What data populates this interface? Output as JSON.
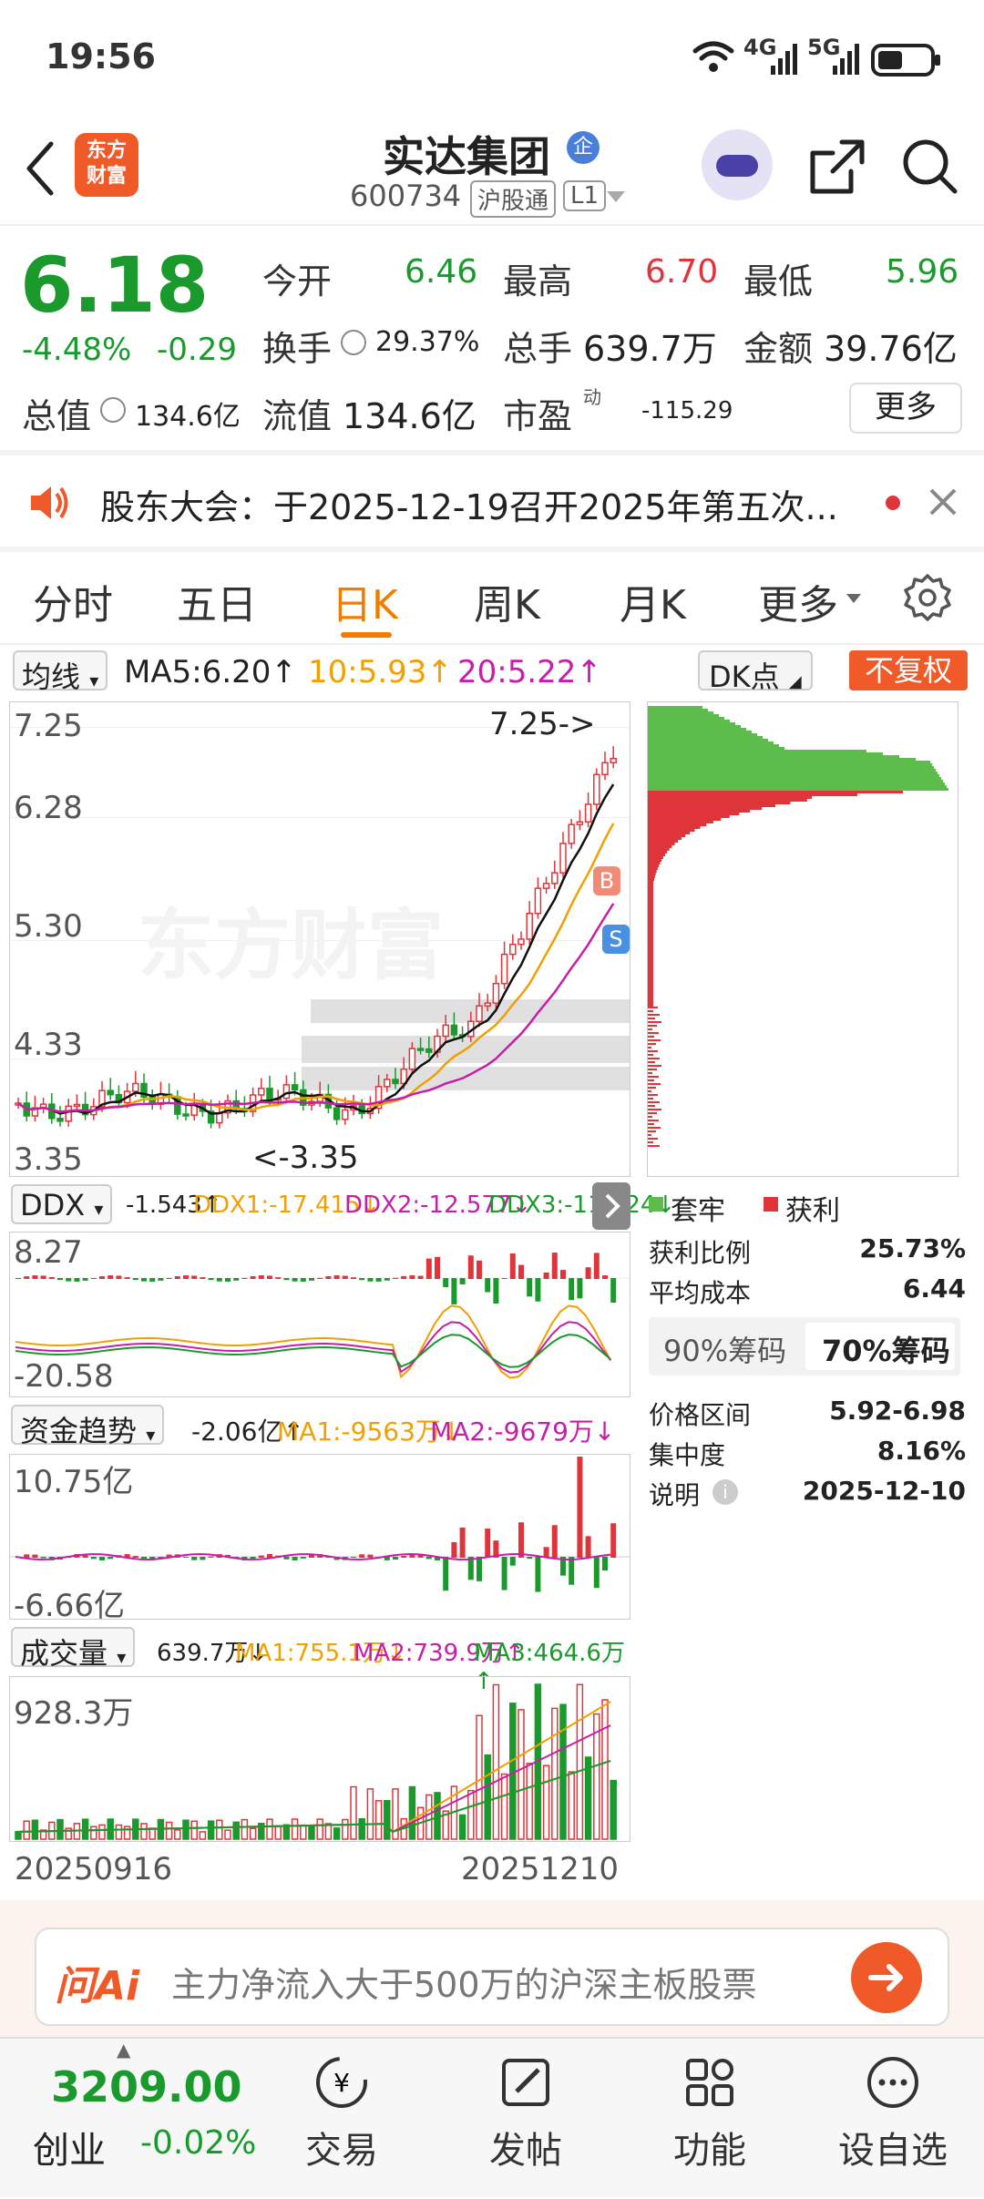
{
  "status": {
    "time": "19:56",
    "net1": "4G",
    "net2": "5G"
  },
  "header": {
    "title": "实达集团",
    "badge": "企",
    "code": "600734",
    "tag1": "沪股通",
    "tag2": "L1",
    "logo": "东方\n财富"
  },
  "quote": {
    "price": "6.18",
    "pct": "-4.48%",
    "chg": "-0.29",
    "open_label": "今开",
    "open": "6.46",
    "high_label": "最高",
    "high": "6.70",
    "low_label": "最低",
    "low": "5.96",
    "turnover_label": "换手",
    "turnover": "29.37%",
    "volume_label": "总手",
    "volume": "639.7万",
    "amount_label": "金额",
    "amount": "39.76亿",
    "mcap_label": "总值",
    "mcap": "134.6亿",
    "float_label": "流值",
    "float": "134.6亿",
    "pe_label": "市盈",
    "pe_sup": "动",
    "pe": "-115.29",
    "more": "更多"
  },
  "notice": {
    "text": "股东大会：于2025-12-19召开2025年第五次..."
  },
  "tabs": [
    "分时",
    "五日",
    "日K",
    "周K",
    "月K",
    "更多"
  ],
  "active_tab": 2,
  "ma_bar": {
    "select": "均线",
    "ma5": "MA5:6.20↑",
    "ma10": "10:5.93↑",
    "ma20": "20:5.22↑",
    "dk": "DK点",
    "fq": "不复权"
  },
  "kline": {
    "y_labels": [
      "7.25",
      "6.28",
      "5.30",
      "4.33",
      "3.35"
    ],
    "high_marker": "7.25->",
    "low_marker": "<-3.35",
    "watermark": "东方财富",
    "b": "B",
    "s": "S"
  },
  "ddx": {
    "select": "DDX",
    "v": "-1.543↑",
    "d1": "DDX1:-17.415↓",
    "d2": "DDX2:-12.577↓",
    "d3": "DDX3:-11.924↓",
    "top": "8.27",
    "bottom": "-20.58"
  },
  "fund": {
    "select": "资金趋势",
    "v": "-2.06亿↑",
    "ma1": "MA1:-9563万↓",
    "ma2": "MA2:-9679万↓",
    "top": "10.75亿",
    "bottom": "-6.66亿"
  },
  "vol": {
    "select": "成交量",
    "v": "639.7万↓",
    "ma1": "MA1:755.1万↓",
    "ma2": "MA2:739.9万↑",
    "ma3": "MA3:464.6万↑",
    "top": "928.3万"
  },
  "dates": {
    "start": "20250916",
    "end": "20251210"
  },
  "chip": {
    "legend1": "套牢",
    "legend2": "获利",
    "rows": [
      {
        "label": "获利比例",
        "value": "25.73%"
      },
      {
        "label": "平均成本",
        "value": "6.44"
      }
    ],
    "btn90": "90%筹码",
    "btn70": "70%筹码",
    "rows2": [
      {
        "label": "价格区间",
        "value": "5.92-6.98"
      },
      {
        "label": "集中度",
        "value": "8.16%"
      },
      {
        "label": "说明",
        "value": "2025-12-10"
      }
    ]
  },
  "ai": {
    "logo": "问Ai",
    "placeholder": "主力净流入大于500万的沪深主板股票"
  },
  "bottom": {
    "index_value": "3209.00",
    "index_name": "创业",
    "index_pct": "-0.02%",
    "items": [
      "交易",
      "发帖",
      "功能",
      "设自选"
    ]
  },
  "colors": {
    "up": "#e0343b",
    "down": "#1a9a2c",
    "accent": "#f07d00"
  }
}
